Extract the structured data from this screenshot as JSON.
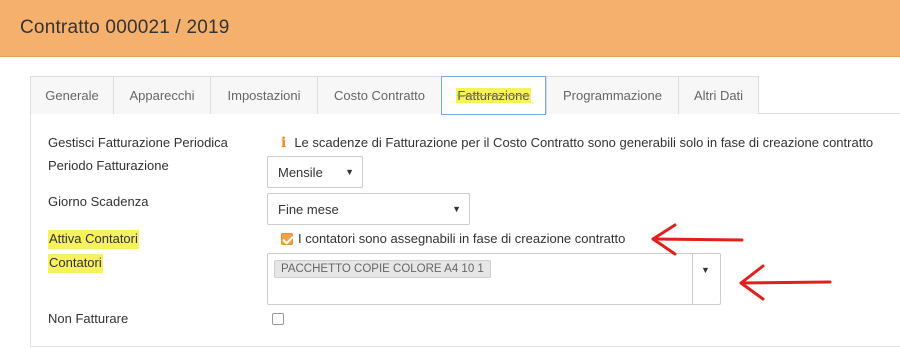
{
  "header": {
    "title": "Contratto 000021 / 2019"
  },
  "tabs": [
    {
      "label": "Generale"
    },
    {
      "label": "Apparecchi"
    },
    {
      "label": "Impostazioni"
    },
    {
      "label": "Costo Contratto"
    },
    {
      "label": "Fatturazione",
      "active": true
    },
    {
      "label": "Programmazione"
    },
    {
      "label": "Altri Dati"
    }
  ],
  "form": {
    "gestisci_label": "Gestisci Fatturazione Periodica",
    "info_text": "Le scadenze di Fatturazione per il Costo Contratto sono generabili solo in fase di creazione contratto",
    "periodo_label": "Periodo Fatturazione",
    "periodo_value": "Mensile",
    "giorno_label": "Giorno Scadenza",
    "giorno_value": "Fine mese",
    "attiva_label": "Attiva Contatori",
    "attiva_checked": true,
    "attiva_text": "I contatori sono assegnabili in fase di creazione contratto",
    "contatori_label": "Contatori",
    "contatori_tags": [
      "PACCHETTO COPIE COLORE A4 10 1"
    ],
    "non_fatturare_label": "Non Fatturare",
    "non_fatturare_checked": false
  },
  "colors": {
    "header_bg": "#f6b06d",
    "highlight": "#f5f25a",
    "checkbox_checked": "#f0a34a",
    "annotation_arrow": "#e0201c",
    "active_tab_border": "#7fa7dd"
  }
}
